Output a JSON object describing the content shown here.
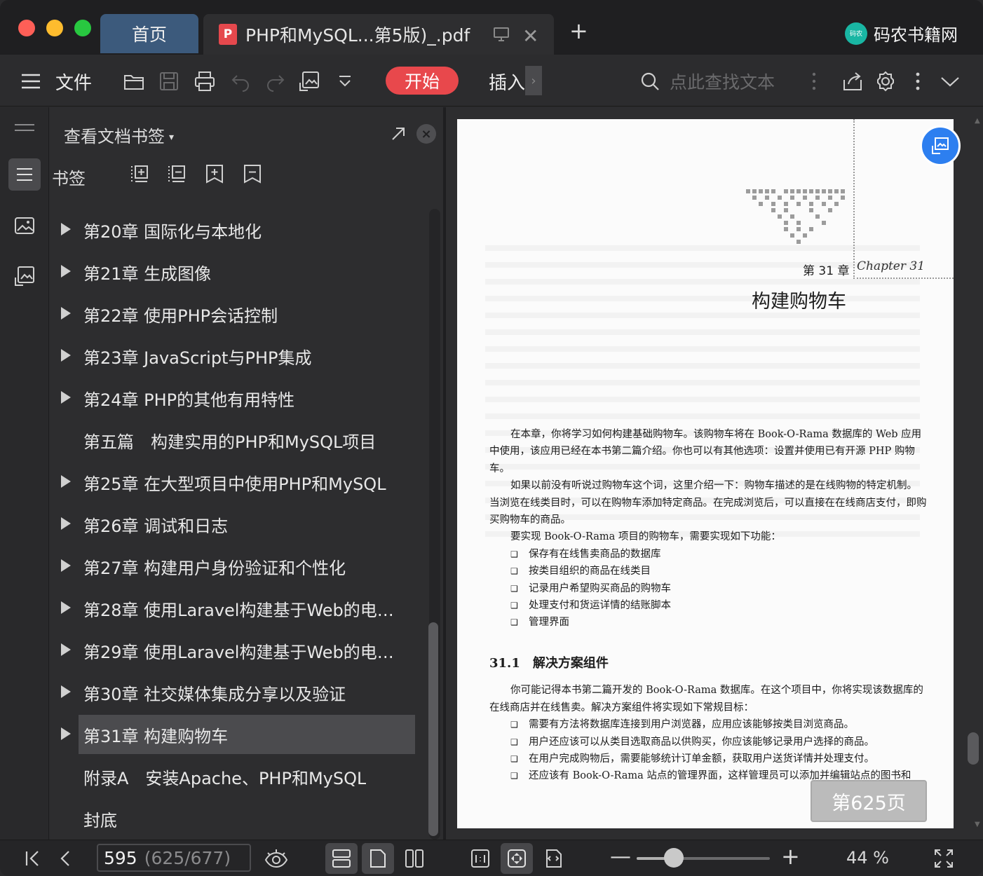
{
  "titlebar": {
    "home_tab": "首页",
    "doc_tab": "PHP和MySQL...第5版)_.pdf",
    "pdf_icon_glyph": "P",
    "brand_logo_text": "码农",
    "brand_name": "码农书籍网",
    "new_tab": "+"
  },
  "toolbar": {
    "file_label": "文件",
    "start_label": "开始",
    "insert_label": "插入",
    "insert_more": "›",
    "search_placeholder": "点此查找文本"
  },
  "panel": {
    "title": "查看文档书签",
    "caret": "▾",
    "close": "×",
    "bookmarks_label": "书签",
    "items": [
      {
        "label": "第20章 国际化与本地化",
        "expandable": true
      },
      {
        "label": "第21章 生成图像",
        "expandable": true
      },
      {
        "label": "第22章 使用PHP会话控制",
        "expandable": true
      },
      {
        "label": "第23章 JavaScript与PHP集成",
        "expandable": true
      },
      {
        "label": "第24章 PHP的其他有用特性",
        "expandable": true
      },
      {
        "label": "第五篇　构建实用的PHP和MySQL项目",
        "expandable": false
      },
      {
        "label": "第25章 在大型项目中使用PHP和MySQL",
        "expandable": true
      },
      {
        "label": "第26章 调试和日志",
        "expandable": true
      },
      {
        "label": "第27章 构建用户身份验证和个性化",
        "expandable": true
      },
      {
        "label": "第28章 使用Laravel构建基于Web的电…",
        "expandable": true
      },
      {
        "label": "第29章 使用Laravel构建基于Web的电…",
        "expandable": true
      },
      {
        "label": "第30章 社交媒体集成分享以及验证",
        "expandable": true
      },
      {
        "label": "第31章 构建购物车",
        "expandable": true,
        "selected": true
      },
      {
        "label": "附录A　安装Apache、PHP和MySQL",
        "expandable": false
      },
      {
        "label": "封底",
        "expandable": false
      }
    ]
  },
  "page": {
    "chapter_number": "第 31 章",
    "chapter_script": "Chapter 31",
    "chapter_title": "构建购物车",
    "p1": "在本章，你将学习如何构建基础购物车。该购物车将在 Book-O-Rama 数据库的 Web 应用中使用，该应用已经在本书第二篇介绍。你也可以有其他选项：设置并使用已有开源 PHP 购物车。",
    "p2": "如果以前没有听说过购物车这个词，这里介绍一下：购物车描述的是在线购物的特定机制。当浏览在线类目时，可以在购物车添加特定商品。在完成浏览后，可以直接在在线商店支付，即购买购物车的商品。",
    "p3": "要实现 Book-O-Rama 项目的购物车，需要实现如下功能：",
    "list1": [
      "保存有在线售卖商品的数据库",
      "按类目组织的商品在线类目",
      "记录用户希望购买商品的购物车",
      "处理支付和货运详情的结账脚本",
      "管理界面"
    ],
    "section_heading": "31.1　解决方案组件",
    "p4": "你可能记得本书第二篇开发的 Book-O-Rama 数据库。在这个项目中，你将实现该数据库的在线商店并在线售卖。解决方案组件将实现如下常规目标：",
    "list2": [
      "需要有方法将数据库连接到用户浏览器，应用应该能够按类目浏览商品。",
      "用户还应该可以从类目选取商品以供购买，你应该能够记录用户选择的商品。",
      "在用户完成购物后，需要能够统计订单金额，获取用户送货详情并处理支付。",
      "还应该有 Book-O-Rama 站点的管理界面，这样管理员可以添加并编辑站点的图书和"
    ],
    "page_badge": "第625页"
  },
  "statusbar": {
    "current_page": "595",
    "total_pages": "(625/677)",
    "zoom_value": "44 %",
    "zoom_fraction": 0.28,
    "zoom_minus": "—",
    "zoom_plus": "+"
  },
  "colors": {
    "accent_red": "#e8484c",
    "home_tab_blue": "#3c5a7c",
    "float_blue": "#2d7ff0"
  }
}
